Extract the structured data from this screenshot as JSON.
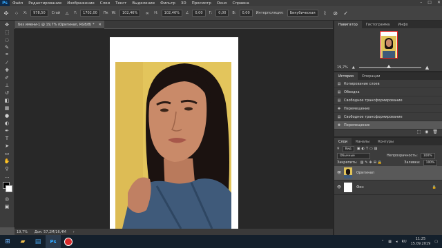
{
  "app": {
    "logo": "Ps"
  },
  "menu": [
    "Файл",
    "Редактирование",
    "Изображение",
    "Слои",
    "Текст",
    "Выделение",
    "Фильтр",
    "3D",
    "Просмотр",
    "Окно",
    "Справка"
  ],
  "options": {
    "x_label": "X:",
    "x_value": "978,50",
    "x_unit": "Сгай",
    "y_label": "Y:",
    "y_value": "1702,00",
    "y_unit": "Пк",
    "w_label": "W:",
    "w_value": "102,46%",
    "h_label": "H:",
    "h_value": "102,46%",
    "angle_value": "0,00",
    "h_skew": "0,00",
    "v_skew": "0,00",
    "interp_label": "Интерполяция:",
    "interp_value": "Бикубическая"
  },
  "document": {
    "tab_title": "Без имени-1 @ 19,7% (Оригинал, RGB/8) *"
  },
  "status": {
    "zoom": "19,7%",
    "doc_info": "Док: 57,2M/16,4M"
  },
  "navigator": {
    "tabs": [
      "Навигатор",
      "Гистограмма",
      "Инфо"
    ],
    "zoom": "19,7%"
  },
  "history": {
    "tabs": [
      "История",
      "Операции"
    ],
    "items": [
      "Копирование слоев",
      "Обводка",
      "Свободное трансформирование",
      "Перемещение",
      "Свободное трансформирование",
      "Перемещение"
    ],
    "selected_index": 5
  },
  "layers": {
    "tabs": [
      "Слои",
      "Каналы",
      "Контуры"
    ],
    "kind_label": "Вид",
    "blend_mode": "Обычные",
    "opacity_label": "Непрозрачность:",
    "opacity_value": "100%",
    "lock_label": "Закрепить:",
    "fill_label": "Заливка:",
    "fill_value": "100%",
    "items": [
      {
        "name": "Оригинал",
        "selected": true
      },
      {
        "name": "Фон",
        "selected": false
      }
    ]
  },
  "taskbar": {
    "lang": "RU",
    "time": "11:25",
    "date": "15.09.2019"
  },
  "colors": {
    "accent": "#31a8ff",
    "canvas_bg": "#282828",
    "photo_bg": "#e0c35a"
  }
}
